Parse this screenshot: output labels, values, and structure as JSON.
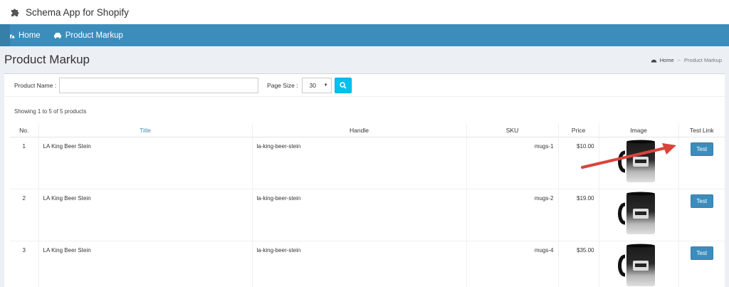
{
  "app": {
    "title": "Schema App for Shopify"
  },
  "nav": {
    "items": [
      {
        "label": "Home",
        "icon": "dashboard-icon"
      },
      {
        "label": "Product Markup",
        "icon": "car-icon"
      }
    ]
  },
  "page": {
    "title": "Product Markup"
  },
  "breadcrumb": {
    "home": "Home",
    "separator": ">",
    "current": "Product Markup"
  },
  "filters": {
    "product_name_label": "Product Name :",
    "product_name_value": "",
    "page_size_label": "Page Size :",
    "page_size_value": "30",
    "search_icon": "search-icon"
  },
  "table": {
    "showing": "Showing 1 to 5 of 5 products",
    "columns": [
      "No.",
      "Title",
      "Handle",
      "SKU",
      "Price",
      "Image",
      "Test Link"
    ],
    "rows": [
      {
        "no": "1",
        "title": "LA King Beer Stein",
        "handle": "la-king-beer-stein",
        "sku": "mugs-1",
        "price": "$10.00",
        "test": "Test"
      },
      {
        "no": "2",
        "title": "LA King Beer Stein",
        "handle": "la-king-beer-stein",
        "sku": "mugs-2",
        "price": "$19.00",
        "test": "Test"
      },
      {
        "no": "3",
        "title": "LA King Beer Stein",
        "handle": "la-king-beer-stein",
        "sku": "mugs-4",
        "price": "$35.00",
        "test": "Test"
      }
    ]
  },
  "colors": {
    "nav": "#3c8dbc",
    "content_bg": "#ecf0f5",
    "search_button": "#00c0ef",
    "arrow": "#d9443b"
  }
}
